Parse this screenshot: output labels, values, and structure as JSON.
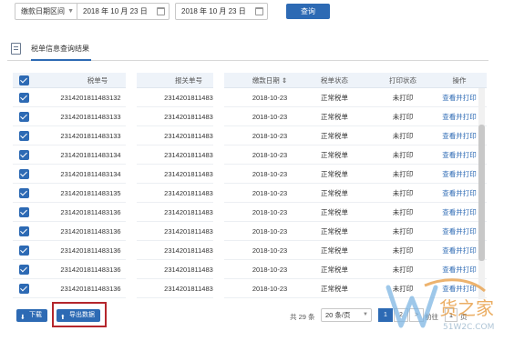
{
  "filter": {
    "type_select": "缴款日期区间",
    "date_from": "2018 年 10 月 23 日",
    "date_to": "2018 年 10 月 23 日",
    "query_label": "查询"
  },
  "tab": {
    "title": "税单信息查询结果"
  },
  "table": {
    "headers": [
      "税单号",
      "报关单号",
      "缴款日期 ⇕",
      "税单状态",
      "打印状态",
      "操作"
    ],
    "rows": [
      {
        "tax_no": "2314201811483132",
        "decl_no": "2314201811483",
        "date": "2018-10-23",
        "status": "正常税单",
        "print": "未打印",
        "action": "查看并打印"
      },
      {
        "tax_no": "2314201811483133",
        "decl_no": "2314201811483",
        "date": "2018-10-23",
        "status": "正常税单",
        "print": "未打印",
        "action": "查看并打印"
      },
      {
        "tax_no": "2314201811483133",
        "decl_no": "2314201811483",
        "date": "2018-10-23",
        "status": "正常税单",
        "print": "未打印",
        "action": "查看并打印"
      },
      {
        "tax_no": "2314201811483134",
        "decl_no": "2314201811483",
        "date": "2018-10-23",
        "status": "正常税单",
        "print": "未打印",
        "action": "查看并打印"
      },
      {
        "tax_no": "2314201811483134",
        "decl_no": "2314201811483",
        "date": "2018-10-23",
        "status": "正常税单",
        "print": "未打印",
        "action": "查看并打印"
      },
      {
        "tax_no": "2314201811483135",
        "decl_no": "2314201811483",
        "date": "2018-10-23",
        "status": "正常税单",
        "print": "未打印",
        "action": "查看并打印"
      },
      {
        "tax_no": "2314201811483136",
        "decl_no": "2314201811483",
        "date": "2018-10-23",
        "status": "正常税单",
        "print": "未打印",
        "action": "查看并打印"
      },
      {
        "tax_no": "2314201811483136",
        "decl_no": "2314201811483",
        "date": "2018-10-23",
        "status": "正常税单",
        "print": "未打印",
        "action": "查看并打印"
      },
      {
        "tax_no": "2314201811483136",
        "decl_no": "2314201811483",
        "date": "2018-10-23",
        "status": "正常税单",
        "print": "未打印",
        "action": "查看并打印"
      },
      {
        "tax_no": "2314201811483136",
        "decl_no": "2314201811483",
        "date": "2018-10-23",
        "status": "正常税单",
        "print": "未打印",
        "action": "查看并打印"
      },
      {
        "tax_no": "2314201811483136",
        "decl_no": "2314201811483",
        "date": "2018-10-23",
        "status": "正常税单",
        "print": "未打印",
        "action": "查看并打印"
      }
    ]
  },
  "footer": {
    "download_label": "下载",
    "export_label": "导出数据",
    "total": "共 29 条",
    "page_size": "20 条/页",
    "pages": [
      "1",
      "2",
      ">"
    ],
    "goto_label": "前往",
    "goto_value": "1",
    "goto_suffix": "页"
  },
  "watermark": {
    "brand": "货之家",
    "url": "51W2C.COM"
  },
  "colors": {
    "primary": "#2d6ab4",
    "highlight_box": "#b4262c",
    "header_bg": "#eef3f9"
  }
}
